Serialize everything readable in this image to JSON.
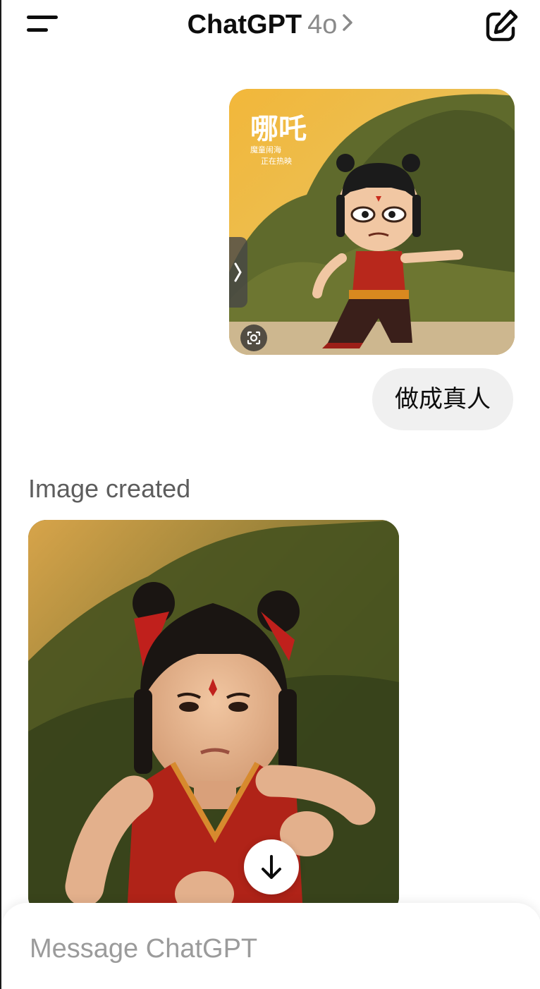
{
  "header": {
    "app_name": "ChatGPT",
    "model": "4o"
  },
  "conversation": {
    "user_message": "做成真人",
    "image_created_label": "Image created"
  },
  "composer": {
    "placeholder": "Message ChatGPT"
  },
  "icons": {
    "menu": "menu-icon",
    "model_chevron": "chevron-right-icon",
    "new_chat": "new-chat-icon",
    "sidebar_tab": "chevron-right-icon",
    "lens": "visual-search-icon",
    "scroll_down": "arrow-down-icon"
  },
  "colors": {
    "text": "#0d0d0d",
    "muted": "#8a8a8a",
    "bubble": "#f0f0f0"
  }
}
